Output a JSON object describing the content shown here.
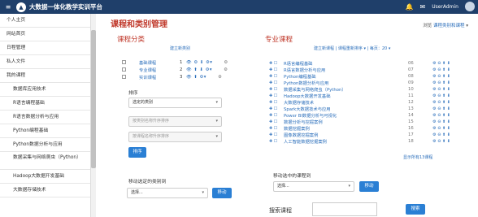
{
  "topbar": {
    "menu_icon": "≡",
    "brand_icon": "🎓",
    "brand": "大数据一体化教学实训平台",
    "user_name": "UserAdmin"
  },
  "sidebar": {
    "items": [
      {
        "label": "个人主页"
      },
      {
        "label": "网站首页"
      },
      {
        "label": "日程管理"
      },
      {
        "label": "私人文件"
      },
      {
        "label": "我的课程"
      },
      {
        "label": "数据库应用技术"
      },
      {
        "label": "R语言编程基础"
      },
      {
        "label": "R语言数据分析与应用"
      },
      {
        "label": "Python编程基础"
      },
      {
        "label": "Python数据分析与应用"
      },
      {
        "label": "数据采集与网络爬虫（Python）"
      },
      {
        "label": "Hadoop大数据开发基础"
      },
      {
        "label": "大数据存储技术"
      }
    ]
  },
  "main": {
    "title": "课程和类别管理",
    "top_link_prefix": "浏览",
    "top_link": "课程类别和课程"
  },
  "category": {
    "title": "课程分类",
    "new_link": "建立新类别",
    "rows": [
      {
        "name": "基础课程",
        "count": "1"
      },
      {
        "name": "专业课程",
        "count": "2"
      },
      {
        "name": "实训课程",
        "count": "3"
      }
    ],
    "sort_label": "排序",
    "sort_select": "选定的类别",
    "sort_opt1": "按类别名称升序排序",
    "sort_opt2": "按课程名称升序排序",
    "sort_button": "排序",
    "move_label": "移动选定的类别到",
    "move_select": "选择...",
    "move_button": "移动"
  },
  "courses": {
    "title": "专业课程",
    "new_course": "建立新课程",
    "sort_link": "课程重新排序",
    "per_page": "每页：20",
    "rows": [
      {
        "name": "R语言编程基础",
        "num": "06"
      },
      {
        "name": "R语言数据分析与应用",
        "num": "07"
      },
      {
        "name": "Python编程基础",
        "num": "08"
      },
      {
        "name": "Python数据分析与应用",
        "num": "09"
      },
      {
        "name": "数据采集与网络爬虫（Python）",
        "num": "10"
      },
      {
        "name": "Hadoop大数据开发基础",
        "num": "11"
      },
      {
        "name": "大数据存储技术",
        "num": "12"
      },
      {
        "name": "Spark大数据技术与应用",
        "num": "13"
      },
      {
        "name": "Power BI数据分析与可视化",
        "num": "14"
      },
      {
        "name": "数据分析与挖掘案例",
        "num": "15"
      },
      {
        "name": "数据挖掘案例",
        "num": "16"
      },
      {
        "name": "图像数据挖掘案例",
        "num": "17"
      },
      {
        "name": "人工智能数据挖掘案例",
        "num": "18"
      }
    ],
    "count_text": "显示所有13课程",
    "move_label": "移动选中的课程到",
    "move_select": "选择...",
    "move_button": "移动"
  },
  "search": {
    "label": "搜索课程",
    "button": "搜索"
  },
  "colors": {
    "navbar": "#1f3f6a",
    "title_red": "#c0392b",
    "link_blue": "#2a6ebb",
    "button_blue": "#2a7fd4"
  }
}
